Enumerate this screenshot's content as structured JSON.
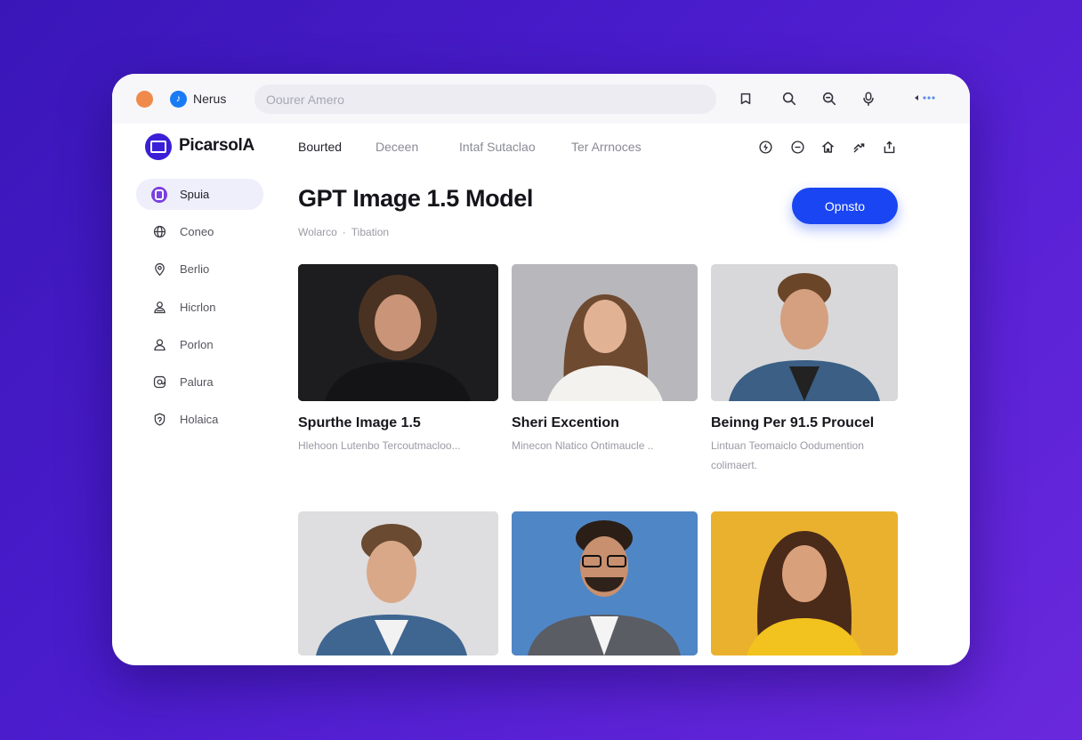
{
  "browser": {
    "app_name": "Nerus",
    "search_placeholder": "Oourer Amero"
  },
  "header": {
    "logo_text": "PicarsolA",
    "tabs": [
      {
        "label": "Bourted",
        "active": true
      },
      {
        "label": "Deceen",
        "active": false
      },
      {
        "label": "Intaf Sutaclao",
        "active": false
      },
      {
        "label": "Ter Arrnoces",
        "active": false
      }
    ]
  },
  "sidebar": {
    "items": [
      {
        "label": "Spuia",
        "icon": "lock-badge-icon",
        "active": true
      },
      {
        "label": "Coneo",
        "icon": "globe-icon",
        "active": false
      },
      {
        "label": "Berlio",
        "icon": "location-pin-icon",
        "active": false
      },
      {
        "label": "Hicrlon",
        "icon": "user-icon",
        "active": false
      },
      {
        "label": "Porlon",
        "icon": "profile-icon",
        "active": false
      },
      {
        "label": "Palura",
        "icon": "at-sign-icon",
        "active": false
      },
      {
        "label": "Holaica",
        "icon": "shield-icon",
        "active": false
      }
    ]
  },
  "main": {
    "title": "GPT Image 1.5 Model",
    "primary_button": "Opnsto",
    "meta_left": "Wolarco",
    "meta_sep": "·",
    "meta_right": "Tibation",
    "cards": [
      {
        "title": "Spurthe Image 1.5",
        "desc": "Hlehoon Lutenbo Tercoutmacloo...",
        "bg": "#1b1b1e"
      },
      {
        "title": "Sheri Excention",
        "desc": "Minecon Nlatico Ontimaucle  ..",
        "bg": "#b9b9bd"
      },
      {
        "title": "Beinng Per 91.5 Proucel",
        "desc": "Lintuan Teomaiclo  Oodumention colimaert.",
        "bg": "#d6d6d8"
      },
      {
        "title": "",
        "desc": "",
        "bg": "#dcdcde"
      },
      {
        "title": "",
        "desc": "",
        "bg": "#4f86c6"
      },
      {
        "title": "",
        "desc": "",
        "bg": "#eab02e"
      }
    ]
  },
  "colors": {
    "accent": "#1a45f2",
    "brand": "#3a1fd6",
    "background": "#4a1ccc"
  }
}
